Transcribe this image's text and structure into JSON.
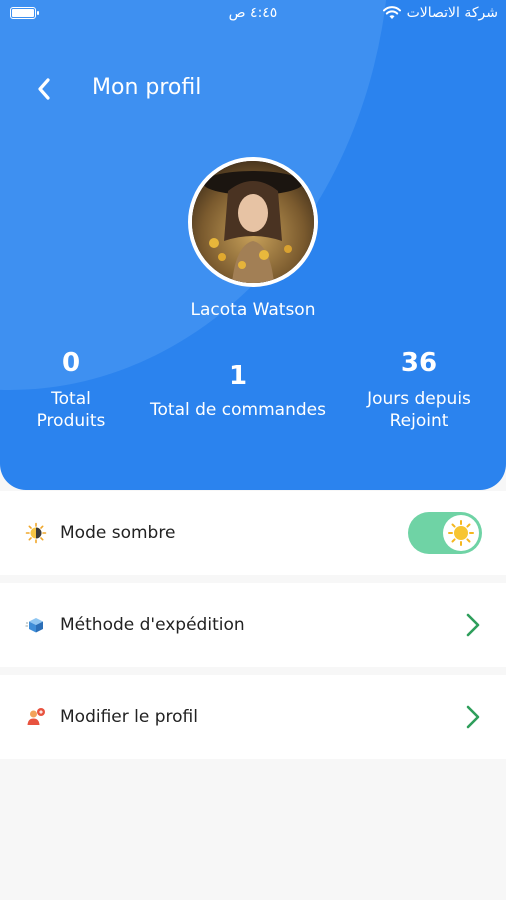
{
  "status_bar": {
    "time": "٤:٤٥ ص",
    "carrier": "شركة الاتصالات",
    "icons": [
      "battery-icon",
      "wifi-icon"
    ]
  },
  "header": {
    "title": "Mon profil",
    "back_icon": "chevron-left-icon",
    "background_color": "#2b83ee"
  },
  "profile": {
    "name": "Lacota Watson",
    "avatar": "profile-photo"
  },
  "stats": [
    {
      "value": "0",
      "label_line1": "Total",
      "label_line2": "Produits"
    },
    {
      "value": "1",
      "label_line1": "Total de commandes",
      "label_line2": ""
    },
    {
      "value": "36",
      "label_line1": "Jours depuis",
      "label_line2": "Rejoint"
    }
  ],
  "settings": [
    {
      "label": "Mode sombre",
      "icon": "sun-moon-icon",
      "control": "toggle",
      "toggle_on": true,
      "toggle_color": "#6fd3a5"
    },
    {
      "label": "Méthode d'expédition",
      "icon": "package-box-icon",
      "control": "chevron-right-icon"
    },
    {
      "label": "Modifier le profil",
      "icon": "user-edit-icon",
      "control": "chevron-right-icon"
    }
  ],
  "colors": {
    "accent": "#2b83ee",
    "chevron": "#2e9e5b",
    "page_bg": "#f7f7f7"
  }
}
